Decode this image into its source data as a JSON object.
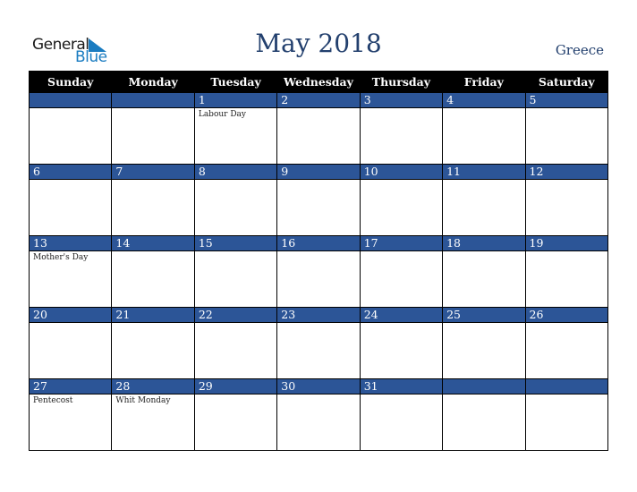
{
  "logo": {
    "line1": "General",
    "line2": "Blue"
  },
  "header": {
    "title": "May 2018",
    "country": "Greece"
  },
  "colors": {
    "accent": "#2c5597",
    "header_bg": "#000000",
    "title": "#23406e",
    "logo_blue": "#1a7cc1"
  },
  "weekdays": [
    "Sunday",
    "Monday",
    "Tuesday",
    "Wednesday",
    "Thursday",
    "Friday",
    "Saturday"
  ],
  "weeks": [
    {
      "days": [
        "",
        "",
        "1",
        "2",
        "3",
        "4",
        "5"
      ],
      "events": [
        "",
        "",
        "Labour Day",
        "",
        "",
        "",
        ""
      ]
    },
    {
      "days": [
        "6",
        "7",
        "8",
        "9",
        "10",
        "11",
        "12"
      ],
      "events": [
        "",
        "",
        "",
        "",
        "",
        "",
        ""
      ]
    },
    {
      "days": [
        "13",
        "14",
        "15",
        "16",
        "17",
        "18",
        "19"
      ],
      "events": [
        "Mother's Day",
        "",
        "",
        "",
        "",
        "",
        ""
      ]
    },
    {
      "days": [
        "20",
        "21",
        "22",
        "23",
        "24",
        "25",
        "26"
      ],
      "events": [
        "",
        "",
        "",
        "",
        "",
        "",
        ""
      ]
    },
    {
      "days": [
        "27",
        "28",
        "29",
        "30",
        "31",
        "",
        ""
      ],
      "events": [
        "Pentecost",
        "Whit Monday",
        "",
        "",
        "",
        "",
        ""
      ]
    }
  ]
}
